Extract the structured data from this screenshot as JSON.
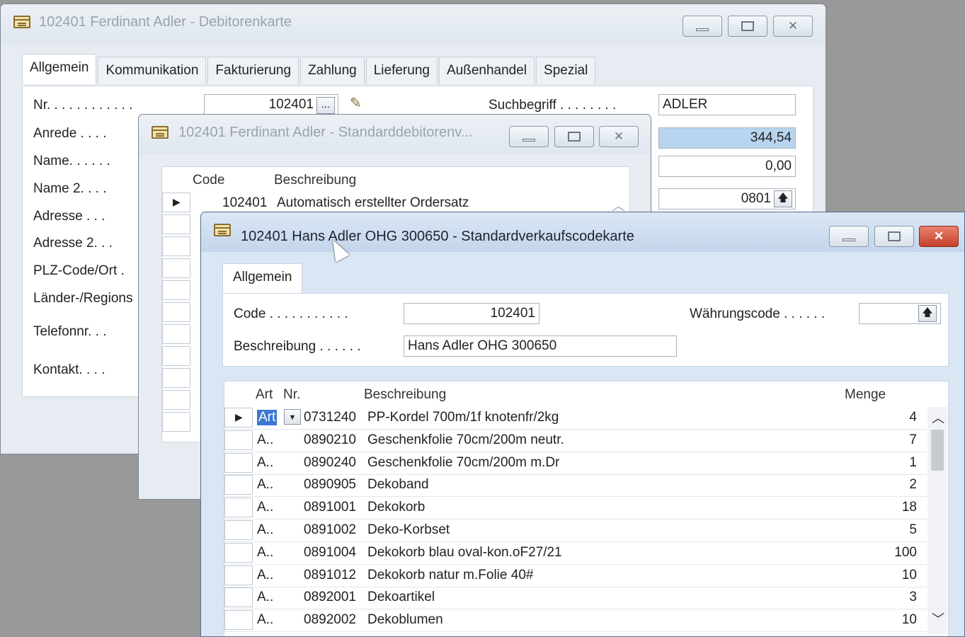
{
  "win1": {
    "title": "102401 Ferdinant Adler - Debitorenkarte",
    "tabs": [
      "Allgemein",
      "Kommunikation",
      "Fakturierung",
      "Zahlung",
      "Lieferung",
      "Außenhandel",
      "Spezial"
    ],
    "labels": {
      "nr": "Nr. . . . . . . . . . . .",
      "anrede": "Anrede . . . .",
      "name": "Name. . . . . .",
      "name2": "Name 2. . . .",
      "adresse": "Adresse . . .",
      "adresse2": "Adresse 2. . .",
      "plz": "PLZ-Code/Ort .",
      "laender": "Länder-/Regions",
      "telefon": "Telefonnr. . .",
      "kontakt": "Kontakt. . . .",
      "suchbegriff": "Suchbegriff . . . . . . . ."
    },
    "nr_value": "102401",
    "suchbegriff_value": "ADLER",
    "right_values": [
      "344,54",
      "0,00",
      "0801"
    ]
  },
  "win2": {
    "title": "102401 Ferdinant Adler - Standarddebitorenv...",
    "col_code": "Code",
    "col_beschreibung": "Beschreibung",
    "row_code": "102401",
    "row_desc": "Automatisch erstellter Ordersatz"
  },
  "win3": {
    "title": "102401 Hans Adler OHG 300650 - Standardverkaufscodekarte",
    "tab": "Allgemein",
    "code_label": "Code . . . . . . . . . . .",
    "code_value": "102401",
    "beschreibung_label": "Beschreibung . . . . . .",
    "beschreibung_value": "Hans Adler OHG 300650",
    "waehrung_label": "Währungscode . . . . . .",
    "waehrung_value": "",
    "headers": {
      "art": "Art",
      "nr": "Nr.",
      "beschreibung": "Beschreibung",
      "menge": "Menge"
    },
    "rows": [
      {
        "art": "Art",
        "nr": "0731240",
        "desc": "PP-Kordel 700m/1f knotenfr/2kg",
        "menge": "4"
      },
      {
        "art": "A..",
        "nr": "0890210",
        "desc": "Geschenkfolie 70cm/200m neutr.",
        "menge": "7"
      },
      {
        "art": "A..",
        "nr": "0890240",
        "desc": "Geschenkfolie 70cm/200m m.Dr",
        "menge": "1"
      },
      {
        "art": "A..",
        "nr": "0890905",
        "desc": "Dekoband",
        "menge": "2"
      },
      {
        "art": "A..",
        "nr": "0891001",
        "desc": "Dekokorb",
        "menge": "18"
      },
      {
        "art": "A..",
        "nr": "0891002",
        "desc": "Deko-Korbset",
        "menge": "5"
      },
      {
        "art": "A..",
        "nr": "0891004",
        "desc": "Dekokorb blau oval-kon.oF27/21",
        "menge": "100"
      },
      {
        "art": "A..",
        "nr": "0891012",
        "desc": "Dekokorb natur m.Folie 40#",
        "menge": "10"
      },
      {
        "art": "A..",
        "nr": "0892001",
        "desc": "Dekoartikel",
        "menge": "3"
      },
      {
        "art": "A..",
        "nr": "0892002",
        "desc": "Dekoblumen",
        "menge": "10"
      }
    ]
  }
}
